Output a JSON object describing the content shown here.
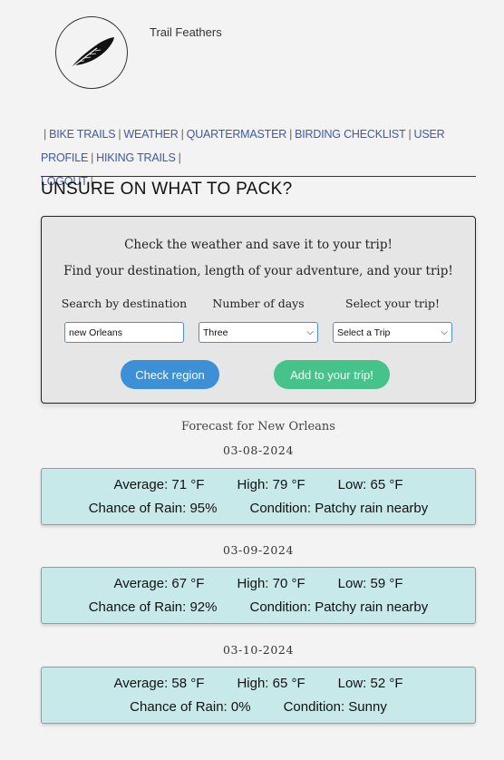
{
  "brand": {
    "name": "Trail Feathers",
    "logo_icon": "feather-icon"
  },
  "nav": {
    "items": [
      {
        "label": "Bike Trails"
      },
      {
        "label": "Weather"
      },
      {
        "label": "Quartermaster"
      },
      {
        "label": "Birding Checklist"
      },
      {
        "label": "User Profile"
      },
      {
        "label": "Hiking Trails"
      },
      {
        "label": "Logout"
      }
    ],
    "separator": "|"
  },
  "heading": "Unsure on what to pack?",
  "panel": {
    "line1": "Check the weather and save it to your trip!",
    "line2": "Find your destination, length of your adventure, and your trip!",
    "search_label": "Search by destination",
    "days_label": "Number of days",
    "trip_label": "Select your trip!",
    "search_value": "new Orleans",
    "days_value": "Three",
    "trip_value": "Select a Trip",
    "check_button": "Check region",
    "add_button": "Add to your trip!"
  },
  "forecast": {
    "title": "Forecast for New Orleans",
    "days": [
      {
        "date": "03-08-2024",
        "average": "Average: 71 °F",
        "high": "High: 79 °F",
        "low": "Low: 65 °F",
        "rain": "Chance of Rain: 95%",
        "condition": "Condition: Patchy rain nearby"
      },
      {
        "date": "03-09-2024",
        "average": "Average: 67 °F",
        "high": "High: 70 °F",
        "low": "Low: 59 °F",
        "rain": "Chance of Rain: 92%",
        "condition": "Condition: Patchy rain nearby"
      },
      {
        "date": "03-10-2024",
        "average": "Average: 58 °F",
        "high": "High: 65 °F",
        "low": "Low: 52 °F",
        "rain": "Chance of Rain: 0%",
        "condition": "Condition: Sunny"
      }
    ]
  },
  "colors": {
    "nav_link": "#3d5aa8",
    "check_button": "#3d8fd6",
    "add_button": "#45c38a",
    "card_bg": "#c8e9ea",
    "panel_bg": "#e6e6e6"
  }
}
